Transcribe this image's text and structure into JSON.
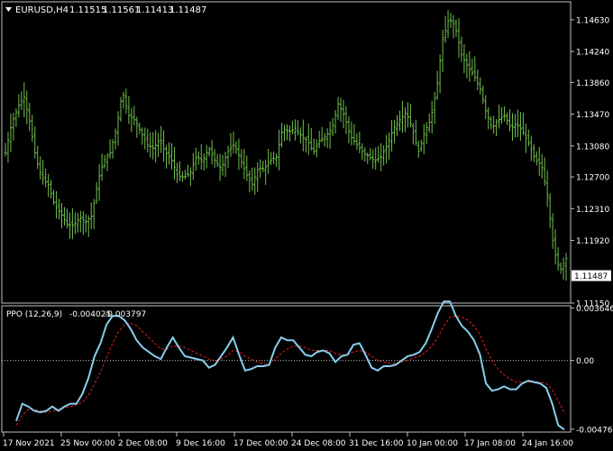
{
  "header": {
    "symbol": "EURUSD,H4",
    "open": "1.11515",
    "high": "1.11561",
    "low": "1.11413",
    "close": "1.11487"
  },
  "indicator": {
    "label": "PPO (12,26,9)",
    "value1": "-0.004025",
    "value2": "-0.003797"
  },
  "colors": {
    "background": "#000000",
    "frame": "#c0c0c0",
    "price_bars": "#6fbf4a",
    "ppo_line": "#87ceeb",
    "signal_line": "#e0201c",
    "text": "#ffffff"
  },
  "chart_data": [
    {
      "type": "line",
      "style": "ohlc-bars",
      "ylim": [
        1.1115,
        1.1485
      ],
      "yticks": [
        "1.14630",
        "1.14240",
        "1.13860",
        "1.13470",
        "1.13080",
        "1.12700",
        "1.12310",
        "1.11920",
        "1.11150"
      ],
      "last_price_label": "1.11487",
      "last_price": 1.11487,
      "xticks": [
        "17 Nov 2021",
        "25 Nov 00:00",
        "2 Dec 08:00",
        "9 Dec 16:00",
        "17 Dec 00:00",
        "24 Dec 08:00",
        "31 Dec 16:00",
        "10 Jan 00:00",
        "17 Jan 08:00",
        "24 Jan 16:00"
      ],
      "series": [
        {
          "values": [
            1.13,
            1.1335,
            1.1355,
            1.137,
            1.1335,
            1.129,
            1.1268,
            1.126,
            1.1235,
            1.1225,
            1.1212,
            1.121,
            1.122,
            1.1215,
            1.1222,
            1.1265,
            1.129,
            1.13,
            1.133,
            1.1375,
            1.1345,
            1.134,
            1.1325,
            1.131,
            1.1305,
            1.1315,
            1.13,
            1.129,
            1.127,
            1.127,
            1.1275,
            1.1295,
            1.129,
            1.1305,
            1.129,
            1.128,
            1.13,
            1.131,
            1.1295,
            1.1275,
            1.126,
            1.128,
            1.128,
            1.129,
            1.1295,
            1.133,
            1.1325,
            1.133,
            1.132,
            1.1315,
            1.13,
            1.1315,
            1.132,
            1.133,
            1.136,
            1.1345,
            1.132,
            1.131,
            1.13,
            1.1295,
            1.129,
            1.1295,
            1.131,
            1.133,
            1.134,
            1.135,
            1.133,
            1.13,
            1.1325,
            1.134,
            1.138,
            1.144,
            1.1465,
            1.1455,
            1.142,
            1.1405,
            1.1395,
            1.138,
            1.135,
            1.133,
            1.134,
            1.1345,
            1.133,
            1.1335,
            1.1325,
            1.131,
            1.129,
            1.1285,
            1.1245,
            1.118,
            1.1155,
            1.117
          ]
        }
      ]
    },
    {
      "type": "line",
      "ylim": [
        -0.00497,
        0.0038
      ],
      "yticks": [
        "0.003646",
        "0.00",
        "-0.004768"
      ],
      "hline": 0,
      "series": [
        {
          "values": [
            -0.0042,
            -0.003,
            -0.0032,
            -0.0035,
            -0.0036,
            -0.0035,
            -0.0032,
            -0.0035,
            -0.0032,
            -0.003,
            -0.003,
            -0.0023,
            -0.0012,
            0.0003,
            0.0012,
            0.0025,
            0.0031,
            0.0031,
            0.0028,
            0.0022,
            0.0014,
            0.0009,
            0.0006,
            0.0003,
            0.0001,
            0.0009,
            0.0016,
            0.0009,
            0.0003,
            0.0002,
            0.0001,
            0.0,
            -0.0005,
            -0.0003,
            0.0003,
            0.0009,
            0.0016,
            0.0004,
            -0.0007,
            -0.0006,
            -0.0004,
            -0.0004,
            -0.0003,
            0.0009,
            0.0016,
            0.0014,
            0.0014,
            0.0009,
            0.0004,
            0.0003,
            0.0006,
            0.0007,
            0.0005,
            -0.0001,
            0.0003,
            0.0004,
            0.0011,
            0.0012,
            0.0004,
            -0.0005,
            -0.0007,
            -0.0004,
            -0.0004,
            -0.0003,
            0.0,
            0.0003,
            0.0004,
            0.0006,
            0.0012,
            0.0022,
            0.0033,
            0.0041,
            0.0041,
            0.0031,
            0.0024,
            0.002,
            0.0014,
            0.0004,
            -0.0016,
            -0.0021,
            -0.002,
            -0.0018,
            -0.002,
            -0.002,
            -0.0016,
            -0.0014,
            -0.0015,
            -0.0016,
            -0.0019,
            -0.003,
            -0.0045,
            -0.0048
          ]
        },
        {
          "values": [
            -0.0045,
            -0.0038,
            -0.0034,
            -0.0034,
            -0.0035,
            -0.0036,
            -0.0035,
            -0.0034,
            -0.0033,
            -0.0032,
            -0.0031,
            -0.0029,
            -0.0024,
            -0.0016,
            -0.0008,
            0.0002,
            0.0012,
            0.002,
            0.0025,
            0.0026,
            0.0024,
            0.002,
            0.0016,
            0.0012,
            0.0008,
            0.0008,
            0.001,
            0.001,
            0.0009,
            0.0007,
            0.0005,
            0.0003,
            0.0001,
            0.0,
            0.0001,
            0.0003,
            0.0007,
            0.0006,
            0.0003,
            0.0001,
            -0.0001,
            -0.0002,
            -0.0002,
            0.0001,
            0.0005,
            0.0008,
            0.001,
            0.001,
            0.0009,
            0.0007,
            0.0007,
            0.0007,
            0.0007,
            0.0005,
            0.0004,
            0.0004,
            0.0006,
            0.0007,
            0.0006,
            0.0003,
            0.0,
            -0.0001,
            -0.0002,
            -0.0002,
            -0.0001,
            0.0,
            0.0002,
            0.0003,
            0.0006,
            0.001,
            0.0016,
            0.0024,
            0.003,
            0.0031,
            0.003,
            0.0028,
            0.0024,
            0.0018,
            0.0008,
            0.0,
            -0.0006,
            -0.001,
            -0.0013,
            -0.0015,
            -0.0015,
            -0.0015,
            -0.0015,
            -0.0015,
            -0.0016,
            -0.002,
            -0.0028,
            -0.0036
          ]
        }
      ]
    }
  ]
}
